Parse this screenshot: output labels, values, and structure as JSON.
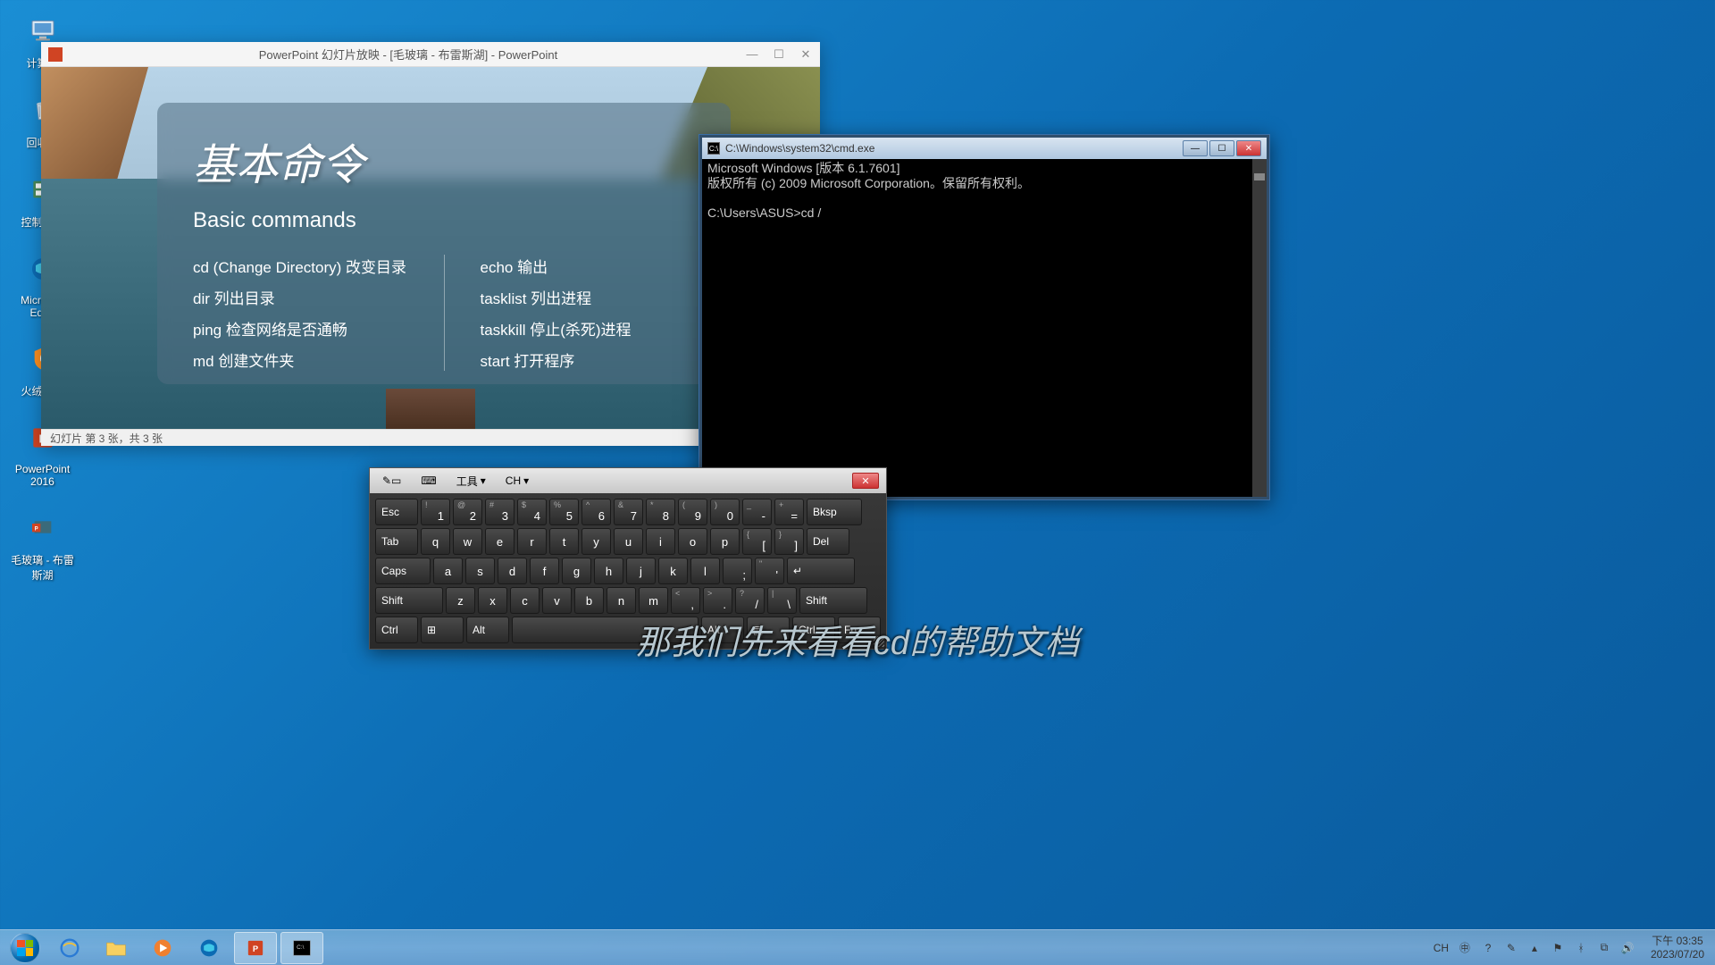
{
  "desktop": {
    "icons": [
      {
        "name": "computer",
        "label": "计算机"
      },
      {
        "name": "recycle-bin",
        "label": "回收站"
      },
      {
        "name": "control-panel",
        "label": "控制面板"
      },
      {
        "name": "edge",
        "label": "Microsoft Edge"
      },
      {
        "name": "huorong",
        "label": "火绒安全"
      },
      {
        "name": "powerpoint",
        "label": "PowerPoint 2016"
      },
      {
        "name": "ppt-file",
        "label": "毛玻璃 - 布雷斯湖"
      }
    ]
  },
  "ppt": {
    "title": "PowerPoint 幻灯片放映 - [毛玻璃 - 布雷斯湖] - PowerPoint",
    "heading_cn": "基本命令",
    "heading_en": "Basic commands",
    "col1": [
      "cd (Change Directory) 改变目录",
      "dir 列出目录",
      "ping 检查网络是否通畅",
      "md 创建文件夹"
    ],
    "col2": [
      "echo 输出",
      "tasklist 列出进程",
      "taskkill 停止(杀死)进程",
      "start 打开程序"
    ],
    "status": "幻灯片 第 3 张，共 3 张"
  },
  "cmd": {
    "title": "C:\\Windows\\system32\\cmd.exe",
    "line1": "Microsoft Windows [版本 6.1.7601]",
    "line2": "版权所有 (c) 2009 Microsoft Corporation。保留所有权利。",
    "prompt": "C:\\Users\\ASUS>cd /"
  },
  "osk": {
    "tools": "工具",
    "lang": "CH",
    "row1": [
      "Esc",
      "!:1",
      "@:2",
      "#:3",
      "$:4",
      "%:5",
      "^:6",
      "&:7",
      "*:8",
      "(:9",
      "):0",
      "_:-",
      "+:=",
      "Bksp"
    ],
    "row2": [
      "Tab",
      "q",
      "w",
      "e",
      "r",
      "t",
      "y",
      "u",
      "i",
      "o",
      "p",
      "{:[",
      "}:]",
      "Del"
    ],
    "row3": [
      "Caps",
      "a",
      "s",
      "d",
      "f",
      "g",
      "h",
      "j",
      "k",
      "l",
      ":;",
      "\":'",
      "↵"
    ],
    "row4": [
      "Shift",
      "z",
      "x",
      "c",
      "v",
      "b",
      "n",
      "m",
      "<:,",
      ">:.",
      "?:/",
      "|:\\",
      "Shift"
    ],
    "row5": [
      "Ctrl",
      "⊞",
      "Alt",
      " ",
      "Alt",
      "▤",
      "Ctrl",
      "Fn"
    ]
  },
  "subtitle": "那我们先来看看cd的帮助文档",
  "taskbar": {
    "tray_lang": "CH",
    "time": "下午 03:35",
    "date": "2023/07/20"
  }
}
